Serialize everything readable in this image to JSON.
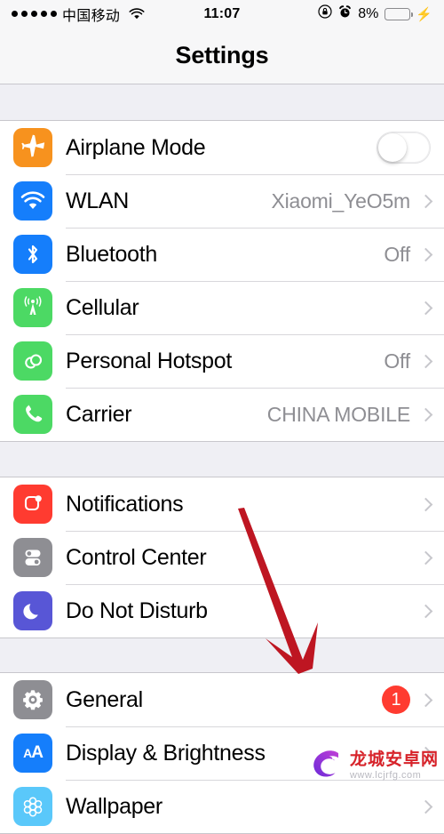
{
  "status_bar": {
    "signal_dots": 5,
    "carrier": "中国移动",
    "wifi_icon": "wifi-icon",
    "time": "11:07",
    "rotation_lock_icon": "rotation-lock-icon",
    "alarm_icon": "alarm-clock-icon",
    "battery_percent": "8%",
    "battery_level": 8,
    "battery_color": "#FFCC00",
    "charging_icon": "lightning-bolt-icon"
  },
  "nav": {
    "title": "Settings"
  },
  "groups": [
    {
      "rows": [
        {
          "label": "Airplane Mode",
          "icon": "airplane-icon",
          "icon_color": "#F7921E",
          "control": "toggle",
          "toggle_on": false
        },
        {
          "label": "WLAN",
          "icon": "wifi-icon",
          "icon_color": "#157EFB",
          "control": "value",
          "value": "Xiaomi_YeO5m"
        },
        {
          "label": "Bluetooth",
          "icon": "bluetooth-icon",
          "icon_color": "#157EFB",
          "control": "value",
          "value": "Off"
        },
        {
          "label": "Cellular",
          "icon": "cellular-antenna-icon",
          "icon_color": "#4CD964",
          "control": "value",
          "value": ""
        },
        {
          "label": "Personal Hotspot",
          "icon": "hotspot-link-icon",
          "icon_color": "#4CD964",
          "control": "value",
          "value": "Off"
        },
        {
          "label": "Carrier",
          "icon": "phone-handset-icon",
          "icon_color": "#4CD964",
          "control": "value",
          "value": "CHINA MOBILE"
        }
      ]
    },
    {
      "rows": [
        {
          "label": "Notifications",
          "icon": "notifications-icon",
          "icon_color": "#FF3B30",
          "control": "value",
          "value": ""
        },
        {
          "label": "Control Center",
          "icon": "control-center-icon",
          "icon_color": "#8E8E93",
          "control": "value",
          "value": ""
        },
        {
          "label": "Do Not Disturb",
          "icon": "moon-icon",
          "icon_color": "#5856D6",
          "control": "value",
          "value": ""
        }
      ]
    },
    {
      "rows": [
        {
          "label": "General",
          "icon": "gear-icon",
          "icon_color": "#8E8E93",
          "control": "badge",
          "badge": "1"
        },
        {
          "label": "Display & Brightness",
          "icon": "text-size-aa-icon",
          "icon_color": "#157EFB",
          "control": "value",
          "value": ""
        },
        {
          "label": "Wallpaper",
          "icon": "wallpaper-flower-icon",
          "icon_color": "#5AC8FA",
          "control": "value",
          "value": ""
        }
      ]
    }
  ],
  "annotation": {
    "arrow_color": "#BE1622",
    "description": "red-arrow-pointing-to-general"
  },
  "watermark": {
    "site_name": "龙城安卓网",
    "url": "www.lcjrfg.com",
    "logo_icon": "dragon-c-logo-icon"
  }
}
